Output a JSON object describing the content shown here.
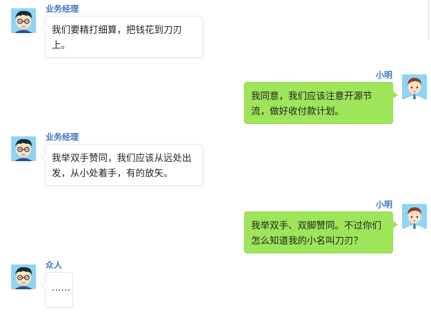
{
  "messages": [
    {
      "side": "left",
      "sender": "业务经理",
      "text_lines": [
        "我们要精打细算，把钱花到刀刃",
        "上。"
      ]
    },
    {
      "side": "right",
      "sender": "小明",
      "text_lines": [
        "我同意，我们应该注意开源节",
        "流，做好收付款计划。"
      ]
    },
    {
      "side": "left",
      "sender": "业务经理",
      "text_lines": [
        "我举双手赞同，我们应该从远处出",
        "发，从小处着手，有的放矢。"
      ]
    },
    {
      "side": "right",
      "sender": "小明",
      "text_lines": [
        "我举双手、双脚赞同。不过你们",
        "怎么知道我的小名叫刀刃？"
      ]
    },
    {
      "side": "left",
      "sender": "众人",
      "text_lines": [
        "……"
      ]
    }
  ],
  "colors": {
    "sender_name": "#3e77c1",
    "self_bubble": "#9ee55a",
    "other_bubble": "#ffffff",
    "avatar_bg": "#8fd4f3"
  },
  "icons": {
    "manager_avatar": "cartoon-man-glasses-avatar",
    "xiaoming_avatar": "cartoon-boy-tie-avatar"
  }
}
